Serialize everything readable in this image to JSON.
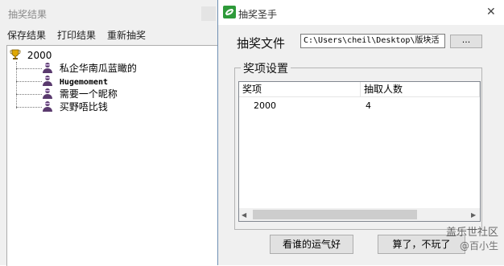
{
  "results_window": {
    "title": "抽奖结果",
    "menu": [
      "保存结果",
      "打印结果",
      "重新抽奖"
    ],
    "tree": {
      "root": "2000",
      "winners": [
        "私企华南瓜蓝瞰的",
        "Hugemoment",
        "需要一个昵称",
        "买野唔比钱"
      ]
    }
  },
  "dialog": {
    "title": "抽奖圣手",
    "file_label": "抽奖文件",
    "file_path": "C:\\Users\\cheil\\Desktop\\版块活",
    "browse_label": "...",
    "group_title": "奖项设置",
    "columns": [
      "奖项",
      "抽取人数"
    ],
    "rows": [
      {
        "prize": "2000",
        "count": "4"
      }
    ],
    "lucky_button": "看谁的运气好",
    "cancel_button": "算了，不玩了",
    "close_glyph": "✕"
  },
  "watermark": {
    "line1": "盖乐世社区",
    "line2": "@百小生"
  },
  "icons": {
    "root": "trophy-icon",
    "winner": "person-icon",
    "app": "app-logo-icon"
  },
  "colors": {
    "dialog_bg": "#f0f0f0",
    "app_icon_green": "#2e9a3a",
    "trophy": "#e0a800",
    "person": "#5a3a6e"
  }
}
